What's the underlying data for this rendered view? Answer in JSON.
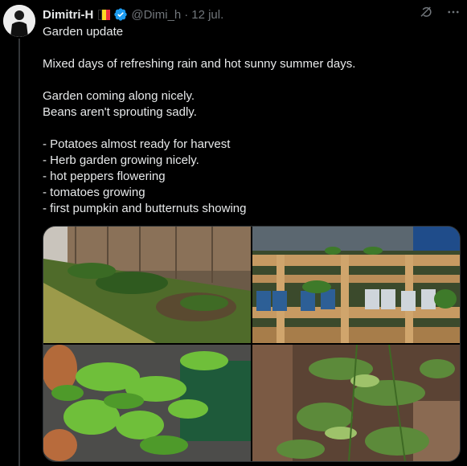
{
  "author": {
    "display_name": "Dimitri-H",
    "handle": "@Dimi_h",
    "separator": "·",
    "date": "12 jul."
  },
  "flag_colors": [
    "#000000",
    "#fdda24",
    "#ef3340"
  ],
  "accent_color": "#1d9bf0",
  "icons": [
    "avatar",
    "flag-icon",
    "verified-badge-icon",
    "grok-icon",
    "more-icon"
  ],
  "tweet": {
    "lines": [
      "Garden update",
      "",
      "Mixed days of refreshing rain and hot sunny summer days.",
      "",
      "Garden coming along nicely.",
      "Beans aren't sprouting sadly.",
      "",
      "- Potatoes almost ready for harvest",
      "- Herb garden growing nicely.",
      "- hot peppers flowering",
      "- tomatoes growing",
      "- first pumpkin and butternuts showing"
    ]
  },
  "media": [
    {
      "name": "garden-bed-photo"
    },
    {
      "name": "pallet-herb-garden-photo"
    },
    {
      "name": "pepper-plant-photo"
    },
    {
      "name": "tomato-plant-photo"
    }
  ]
}
